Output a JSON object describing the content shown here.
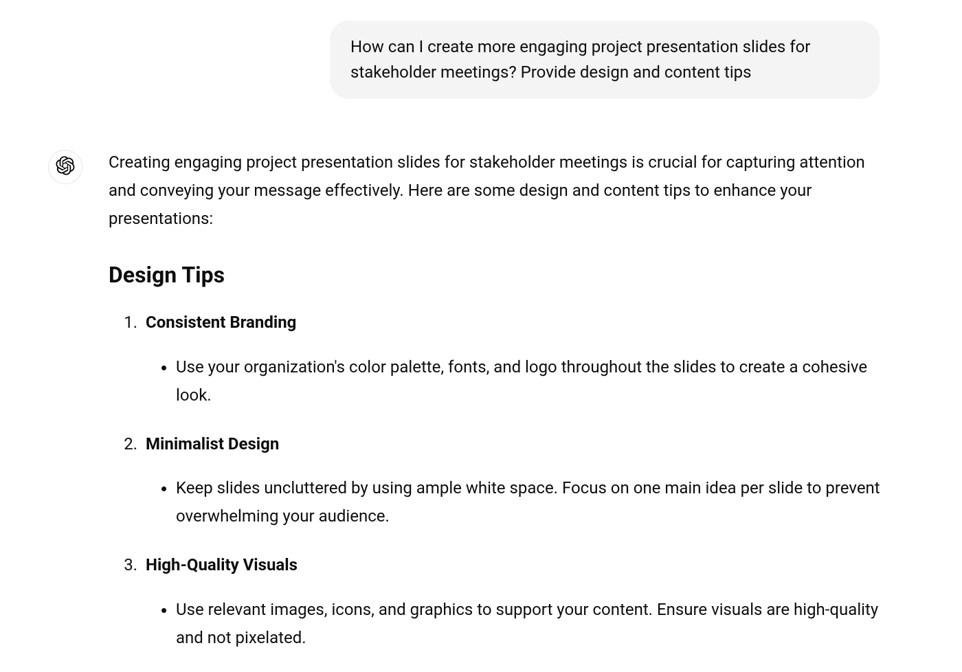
{
  "user_message": "How can I create more engaging project presentation slides for stakeholder meetings? Provide design and content tips",
  "assistant": {
    "intro": "Creating engaging project presentation slides for stakeholder meetings is crucial for capturing attention and conveying your message effectively. Here are some design and content tips to enhance your presentations:",
    "section_heading": "Design Tips",
    "tips": [
      {
        "title": "Consistent Branding",
        "bullets": [
          "Use your organization's color palette, fonts, and logo throughout the slides to create a cohesive look."
        ]
      },
      {
        "title": "Minimalist Design",
        "bullets": [
          "Keep slides uncluttered by using ample white space. Focus on one main idea per slide to prevent overwhelming your audience."
        ]
      },
      {
        "title": "High-Quality Visuals",
        "bullets": [
          "Use relevant images, icons, and graphics to support your content. Ensure visuals are high-quality and not pixelated."
        ]
      }
    ]
  }
}
